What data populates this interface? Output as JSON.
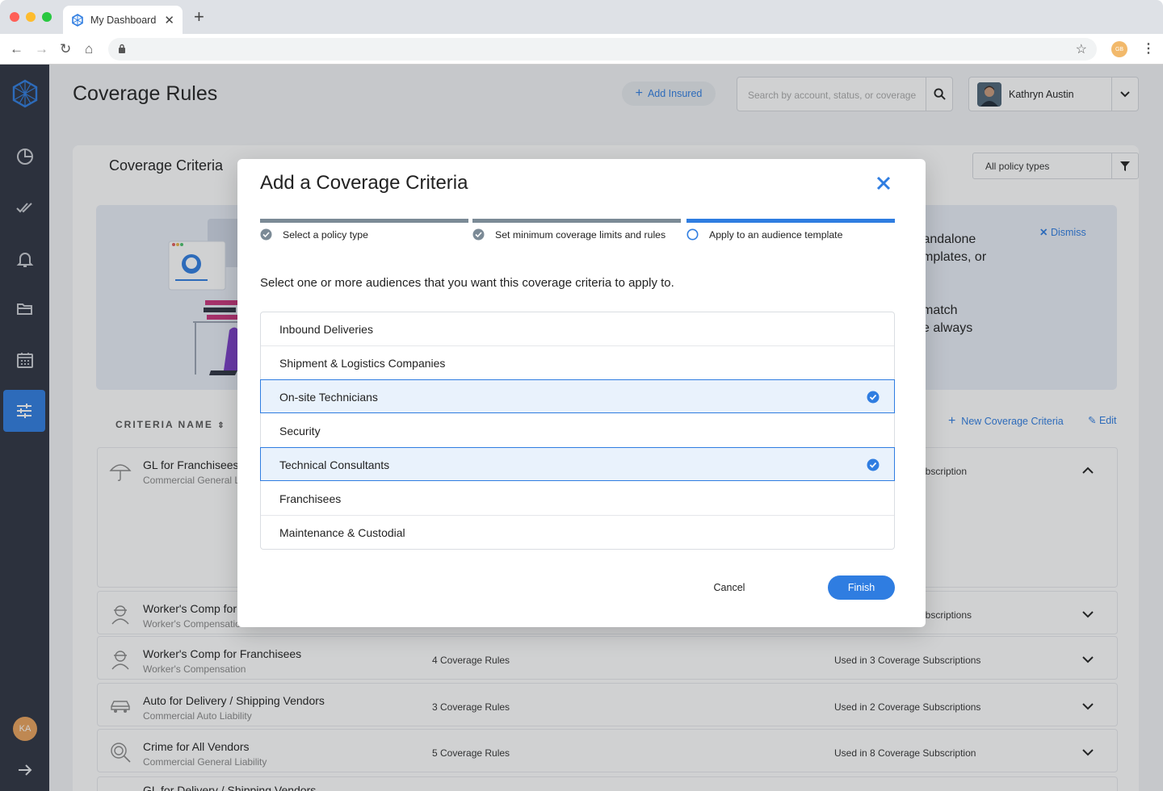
{
  "browser": {
    "tab_title": "My Dashboard",
    "new_tab": "+",
    "profile_initials": "GB"
  },
  "sidebar": {
    "items": [
      {
        "icon": "dashboard-icon"
      },
      {
        "icon": "pie-chart-icon"
      },
      {
        "icon": "double-check-icon"
      },
      {
        "icon": "bell-icon"
      },
      {
        "icon": "folder-icon"
      },
      {
        "icon": "calendar-icon"
      },
      {
        "icon": "sliders-icon",
        "active": true
      }
    ],
    "avatar_initials": "KA",
    "collapse_icon": "arrow-right-icon"
  },
  "header": {
    "title": "Coverage Rules",
    "add_insured": "Add Insured",
    "search_placeholder": "Search by account, status, or coverage",
    "user_name": "Kathryn Austin"
  },
  "card": {
    "tab_title": "Coverage Criteria",
    "policy_filter": "All policy types",
    "banner": {
      "line1": "tandalone",
      "line2": "mplates, or",
      "line3": "match",
      "line4": "e always",
      "dismiss": "Dismiss"
    },
    "column_header": "CRITERIA NAME",
    "new_criteria": "New Coverage Criteria",
    "edit": "Edit",
    "rows": [
      {
        "name": "GL for Franchisees",
        "sub": "Commercial General L",
        "rules": "",
        "used": "ubscription"
      },
      {
        "name": "Worker's Comp for",
        "sub": "Worker's Compensatio",
        "rules": "",
        "used": "ubscriptions"
      },
      {
        "name": "Worker's Comp for Franchisees",
        "sub": "Worker's Compensation",
        "rules": "4 Coverage Rules",
        "used": "Used in 3 Coverage Subscriptions"
      },
      {
        "name": "Auto for Delivery / Shipping Vendors",
        "sub": "Commercial Auto Liability",
        "rules": "3 Coverage Rules",
        "used": "Used in 2 Coverage Subscriptions"
      },
      {
        "name": "Crime for All Vendors",
        "sub": "Commercial General Liability",
        "rules": "5 Coverage Rules",
        "used": "Used in 8 Coverage Subscription"
      },
      {
        "name": "GL for Delivery / Shipping Vendors",
        "sub": "",
        "rules": "",
        "used": ""
      }
    ]
  },
  "modal": {
    "title": "Add a Coverage Criteria",
    "steps": [
      {
        "label": "Select a policy type",
        "state": "done"
      },
      {
        "label": "Set minimum coverage limits and rules",
        "state": "done"
      },
      {
        "label": "Apply to an audience template",
        "state": "active"
      }
    ],
    "intro": "Select one or more audiences that you want this coverage criteria to apply to.",
    "audiences": [
      {
        "label": "Inbound Deliveries",
        "selected": false
      },
      {
        "label": "Shipment & Logistics Companies",
        "selected": false
      },
      {
        "label": "On-site Technicians",
        "selected": true
      },
      {
        "label": "Security",
        "selected": false
      },
      {
        "label": "Technical Consultants",
        "selected": true
      },
      {
        "label": "Franchisees",
        "selected": false
      },
      {
        "label": "Maintenance & Custodial",
        "selected": false
      }
    ],
    "cancel": "Cancel",
    "finish": "Finish"
  },
  "colors": {
    "accent": "#2f7de1",
    "sidebar": "#2d3240",
    "step_done": "#7b8a96",
    "selected_bg": "#e9f2fc"
  }
}
